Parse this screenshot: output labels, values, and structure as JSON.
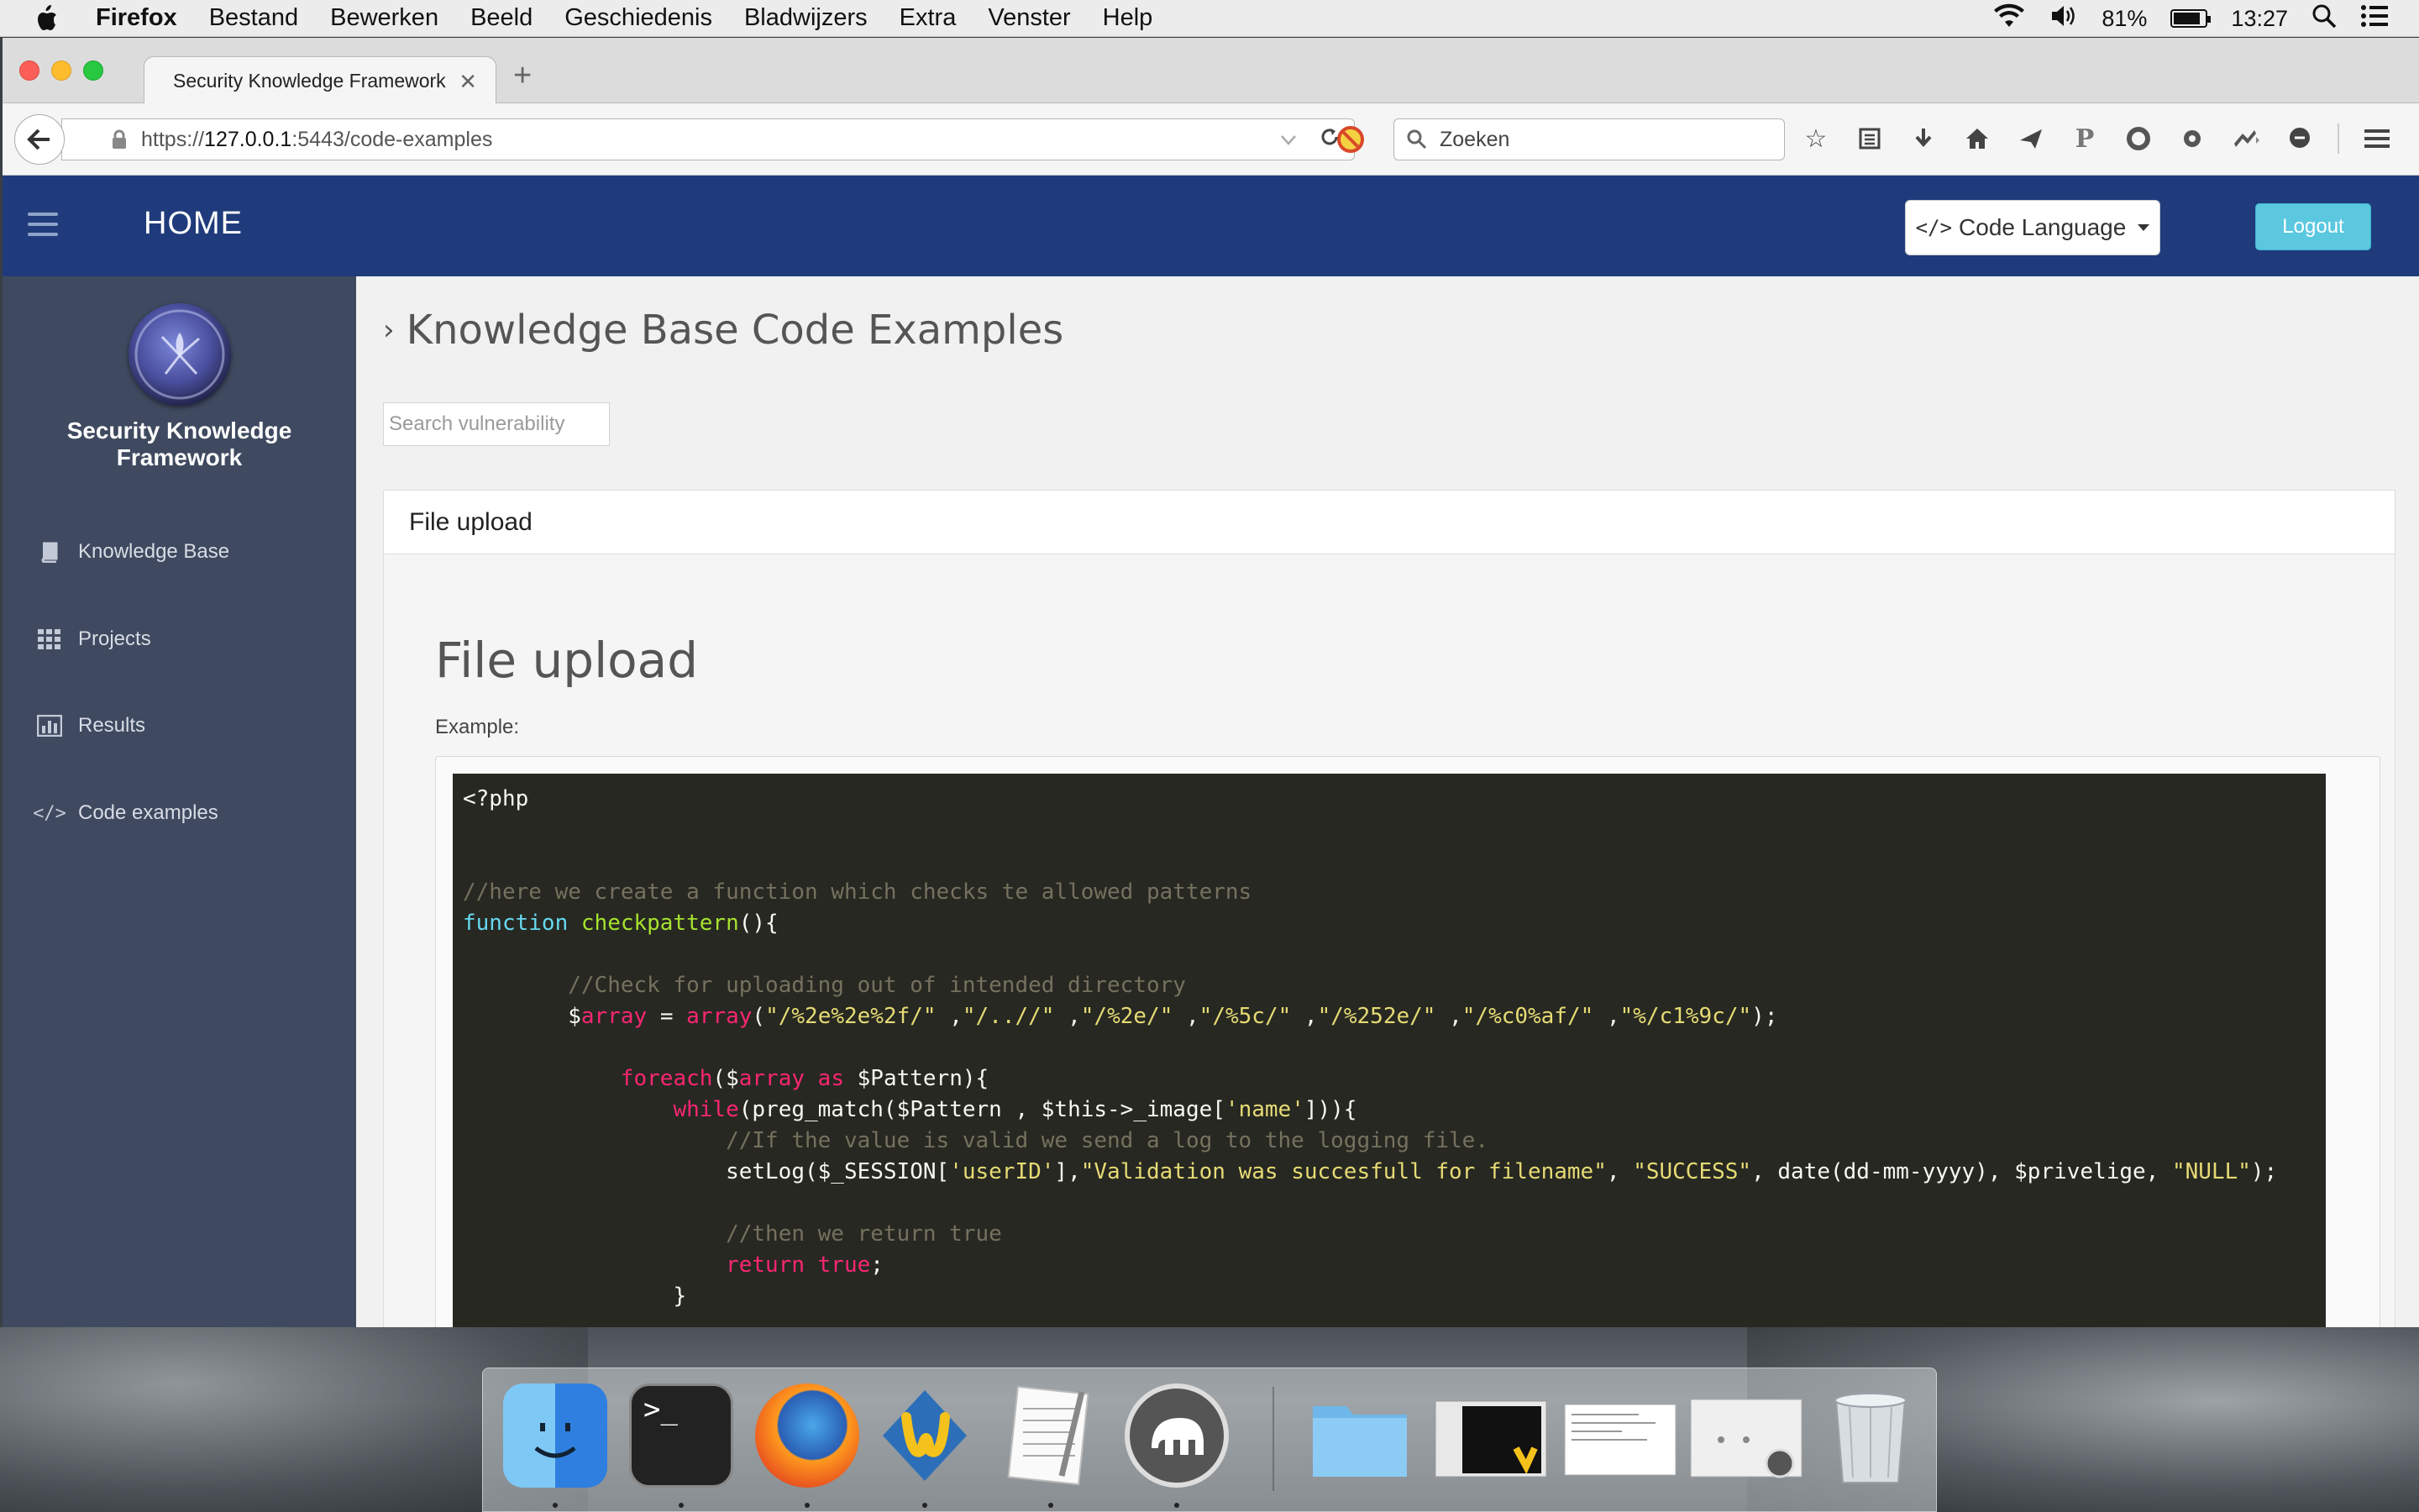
{
  "menubar": {
    "app_name": "Firefox",
    "items": [
      "Bestand",
      "Bewerken",
      "Beeld",
      "Geschiedenis",
      "Bladwijzers",
      "Extra",
      "Venster",
      "Help"
    ],
    "battery_percent": "81%",
    "battery_level": 0.81,
    "clock": "13:27"
  },
  "browser": {
    "tab_title": "Security Knowledge Framework",
    "url_prefix": "https://",
    "url_host": "127.0.0.1",
    "url_rest": ":5443/code-examples",
    "search_placeholder": "Zoeken"
  },
  "app": {
    "home_label": "HOME",
    "code_language_label": "Code Language",
    "logout_label": "Logout",
    "brand_line1": "Security Knowledge",
    "brand_line2": "Framework",
    "sidebar": {
      "items": [
        {
          "label": "Knowledge Base",
          "icon": "book-icon"
        },
        {
          "label": "Projects",
          "icon": "grid-icon"
        },
        {
          "label": "Results",
          "icon": "bar-chart-icon"
        },
        {
          "label": "Code examples",
          "icon": "code-icon"
        }
      ]
    },
    "page_title": "Knowledge Base Code Examples",
    "search_placeholder": "Search vulnerability",
    "panel_title": "File upload",
    "example_title": "File upload",
    "example_label": "Example:"
  },
  "code": {
    "language": "php",
    "lines": [
      "<?php",
      "",
      "",
      "//here we create a function which checks te allowed patterns",
      "function checkpattern(){",
      "",
      "        //Check for uploading out of intended directory",
      "        $array = array(\"/%2e%2e%2f/\" ,\"/..//\" ,\"/%2e/\" ,\"/%5c/\" ,\"/%252e/\" ,\"/%c0%af/\" ,\"%/c1%9c/\");",
      "",
      "            foreach($array as $Pattern){",
      "                while(preg_match($Pattern , $this->_image['name'])){",
      "                    //If the value is valid we send a log to the logging file.",
      "                    setLog($_SESSION['userID'],\"Validation was succesfull for filename\", \"SUCCESS\", date(dd-mm-yyyy), $privelige, \"NULL\");",
      "",
      "                    //then we return true",
      "                    return true;",
      "                }"
    ]
  },
  "dock": {
    "apps": [
      "finder-icon",
      "terminal-icon",
      "firefox-icon",
      "wing-ide-icon",
      "textedit-icon",
      "mamp-icon",
      "folder-icon",
      "window-preview",
      "document-preview",
      "mamp-window-preview",
      "trash-icon"
    ]
  }
}
